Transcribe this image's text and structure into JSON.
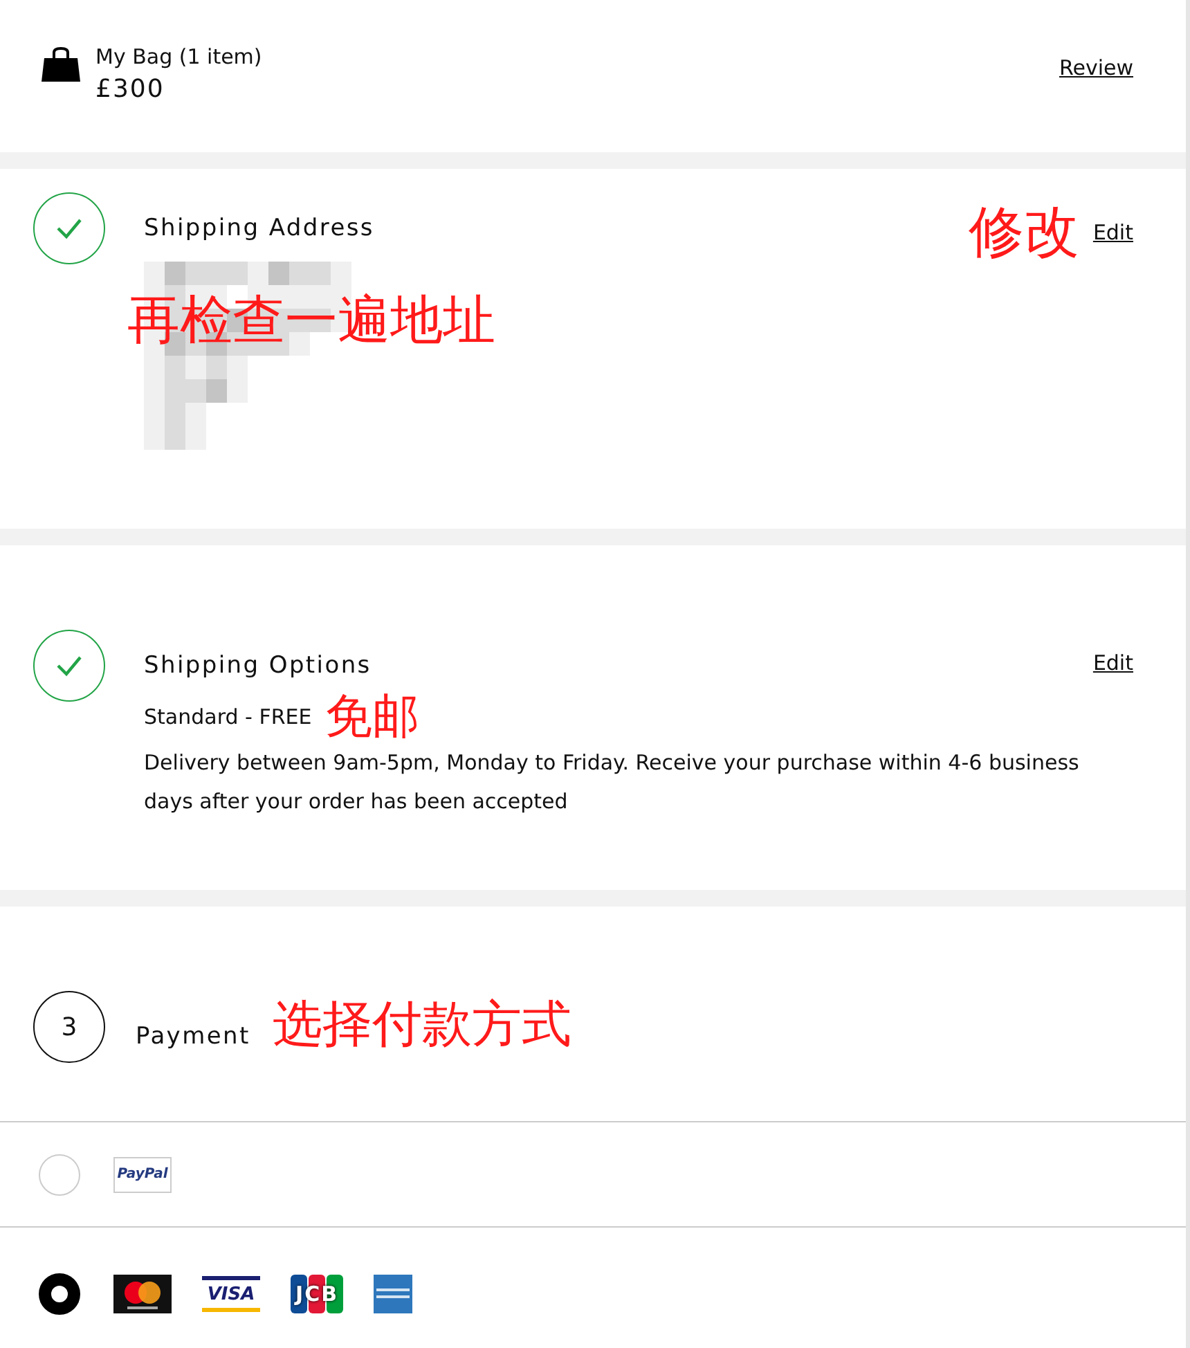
{
  "bag": {
    "title": "My Bag (1 item)",
    "total": "£300",
    "review_link": "Review"
  },
  "steps": [
    {
      "kind": "done",
      "title": "Shipping Address",
      "edit": "Edit",
      "annotation": "再检查一遍地址",
      "edit_annotation": "修改",
      "redacted": true
    },
    {
      "kind": "done",
      "title": "Shipping Options",
      "edit": "Edit",
      "option": "Standard - FREE",
      "option_annotation": "免邮",
      "description": "Delivery between 9am-5pm, Monday to Friday. Receive your purchase within 4-6 business days after your order has been accepted"
    },
    {
      "kind": "number",
      "marker": "3",
      "title": "Payment",
      "annotation": "选择付款方式"
    }
  ],
  "payment_methods": [
    {
      "selected": false,
      "logos": [
        {
          "kind": "paypal",
          "label": "PayPal"
        }
      ]
    },
    {
      "selected": true,
      "logos": [
        {
          "kind": "mastercard"
        },
        {
          "kind": "visa",
          "label": "VISA"
        },
        {
          "kind": "jcb",
          "label": "JCB"
        },
        {
          "kind": "amex"
        }
      ]
    }
  ]
}
